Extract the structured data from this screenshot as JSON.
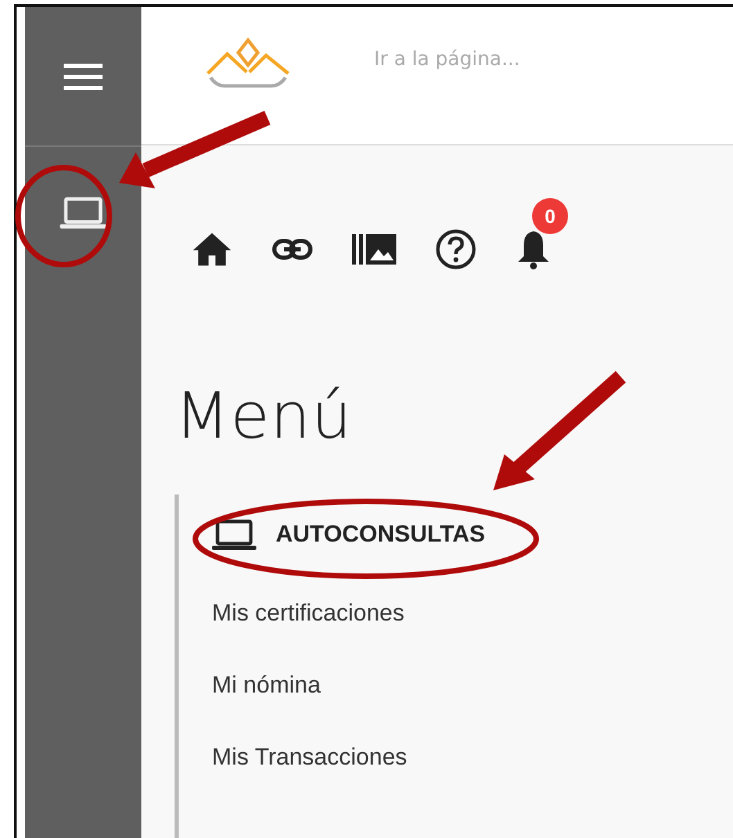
{
  "header": {
    "search": {
      "placeholder": "Ir a la página..."
    }
  },
  "toolbar": {
    "notification_count": "0"
  },
  "title": "Menú",
  "menu": {
    "section": "AUTOCONSULTAS",
    "items": [
      "Mis certificaciones",
      "Mi nómina",
      "Mis Transacciones"
    ]
  }
}
